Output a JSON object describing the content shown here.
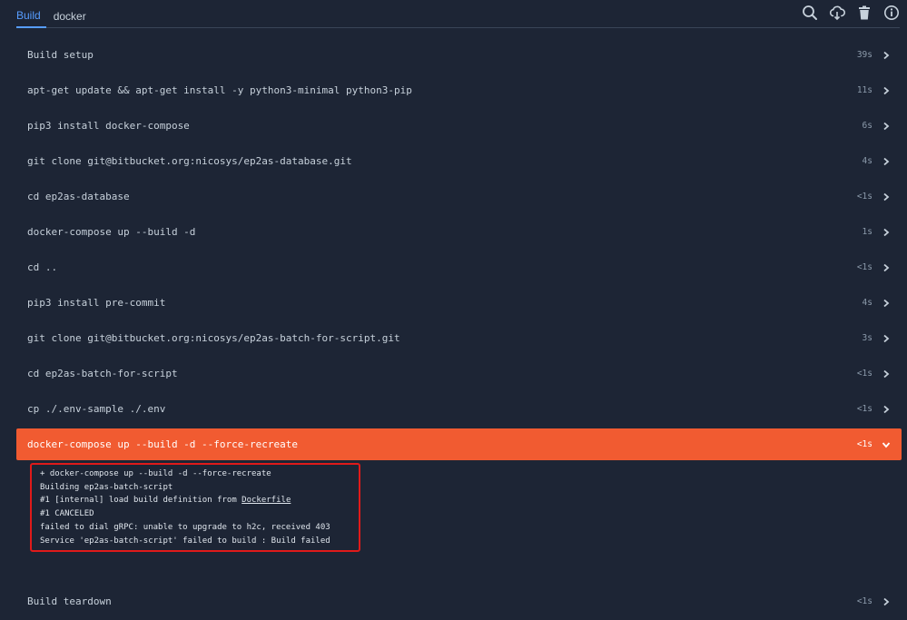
{
  "tabs": [
    {
      "label": "Build",
      "active": true
    },
    {
      "label": "docker",
      "active": false
    }
  ],
  "toolbar": {
    "icons": [
      "search-icon",
      "cloud-download-icon",
      "trash-icon",
      "info-icon"
    ]
  },
  "steps": [
    {
      "cmd": "Build setup",
      "dur": "39s"
    },
    {
      "cmd": "apt-get update && apt-get install -y python3-minimal python3-pip",
      "dur": "11s"
    },
    {
      "cmd": "pip3 install docker-compose",
      "dur": "6s"
    },
    {
      "cmd": "git clone git@bitbucket.org:nicosys/ep2as-database.git",
      "dur": "4s"
    },
    {
      "cmd": "cd ep2as-database",
      "dur": "<1s"
    },
    {
      "cmd": "docker-compose up --build -d",
      "dur": "1s"
    },
    {
      "cmd": "cd ..",
      "dur": "<1s"
    },
    {
      "cmd": "pip3 install pre-commit",
      "dur": "4s"
    },
    {
      "cmd": "git clone git@bitbucket.org:nicosys/ep2as-batch-for-script.git",
      "dur": "3s"
    },
    {
      "cmd": "cd ep2as-batch-for-script",
      "dur": "<1s"
    },
    {
      "cmd": "cp ./.env-sample ./.env",
      "dur": "<1s"
    },
    {
      "cmd": "docker-compose up --build -d --force-recreate",
      "dur": "<1s",
      "failed": true
    }
  ],
  "log": {
    "line0": "+ docker-compose up --build -d --force-recreate",
    "line1": "Building ep2as-batch-script",
    "line2_prefix": "#1 [internal] load build definition from ",
    "line2_link": "Dockerfile",
    "line3": "#1 CANCELED",
    "line4": "failed to dial gRPC: unable to upgrade to h2c, received 403",
    "line5": "Service 'ep2as-batch-script' failed to build : Build failed"
  },
  "teardown": {
    "cmd": "Build teardown",
    "dur": "<1s"
  },
  "colors": {
    "background": "#1d2535",
    "accent": "#579dff",
    "failed_step": "#f15b31",
    "highlight_box": "#e01a1a"
  }
}
